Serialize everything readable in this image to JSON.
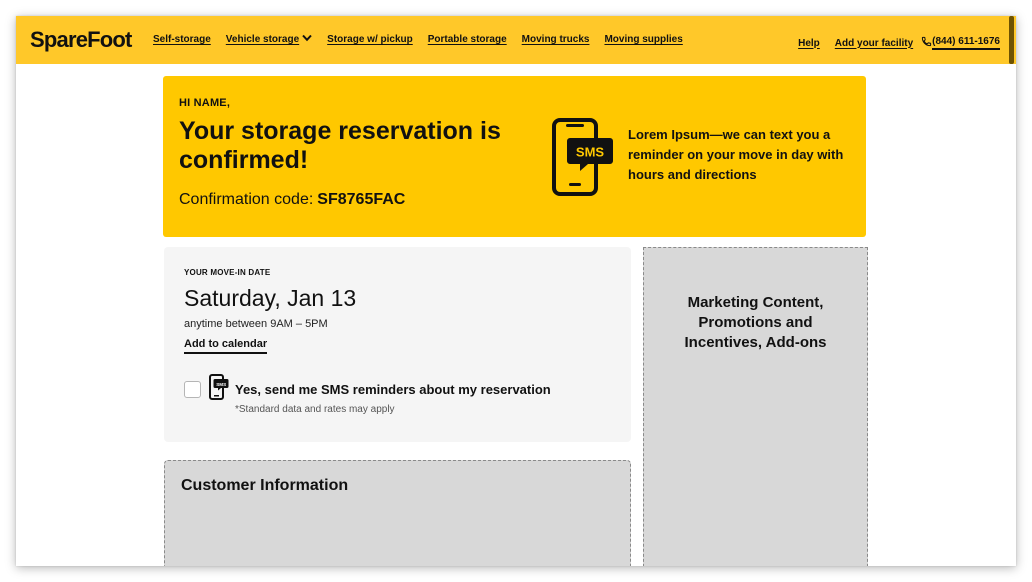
{
  "header": {
    "logo": "SpareFoot",
    "nav": [
      {
        "label": "Self-storage"
      },
      {
        "label": "Vehicle storage",
        "has_dropdown": true
      },
      {
        "label": "Storage w/ pickup"
      },
      {
        "label": "Portable storage"
      },
      {
        "label": "Moving trucks"
      },
      {
        "label": "Moving supplies"
      }
    ],
    "help": "Help",
    "add_facility": "Add your facility",
    "phone": "(844) 611-1676"
  },
  "banner": {
    "greeting": "HI NAME,",
    "headline": "Your storage reservation is confirmed!",
    "confirmation_label": "Confirmation code:",
    "confirmation_code": "SF8765FAC",
    "sms_icon_text": "SMS",
    "sms_promo": "Lorem Ipsum—we can text you a reminder on your move in day with hours and directions"
  },
  "movein": {
    "label": "YOUR MOVE-IN DATE",
    "date": "Saturday, Jan 13",
    "time": "anytime between 9AM – 5PM",
    "add_calendar": "Add to calendar",
    "sms_icon_text": "SMS",
    "sms_optin": "Yes, send me SMS reminders about my reservation",
    "sms_checked": false,
    "disclaimer": "*Standard data and rates may apply"
  },
  "marketing": {
    "text": "Marketing Content, Promotions and Incentives, Add-ons"
  },
  "customer": {
    "title": "Customer Information"
  },
  "colors": {
    "brand_yellow": "#ffc829",
    "banner_yellow": "#ffc800",
    "card_gray": "#f5f5f5",
    "placeholder_gray": "#d8d8d8"
  }
}
